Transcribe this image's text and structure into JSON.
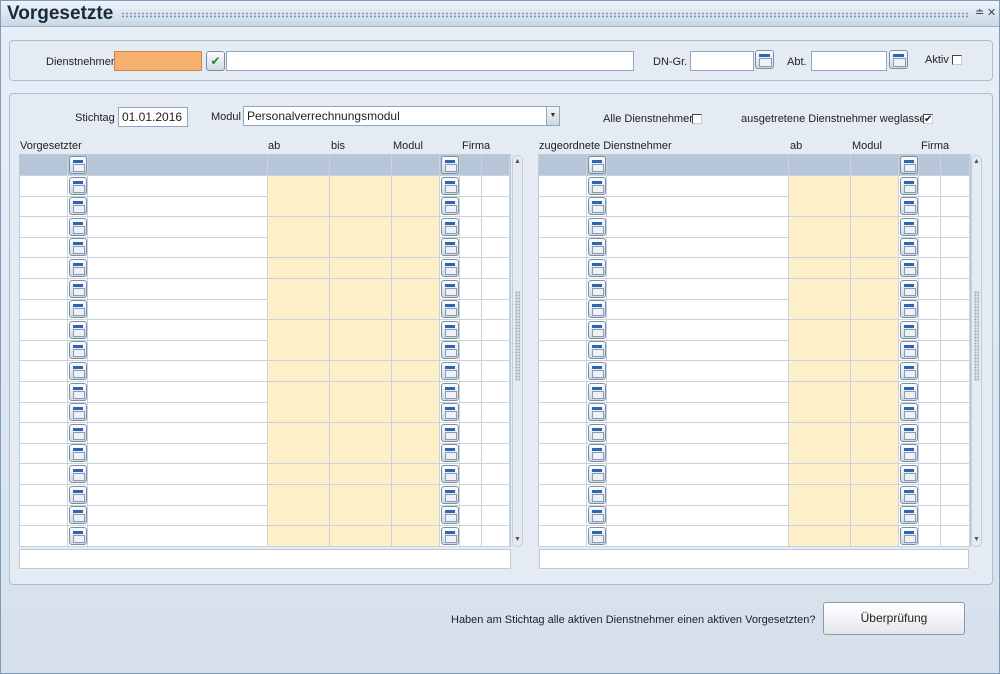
{
  "window": {
    "title": "Vorgesetzte",
    "min_glyph": "≐",
    "close_glyph": "✕"
  },
  "employee_panel": {
    "dienstnehmer_label": "Dienstnehmer",
    "dienstnehmer_value": "",
    "name_value": "",
    "dngr_label": "DN-Gr.",
    "dngr_value": "",
    "abt_label": "Abt.",
    "abt_value": "",
    "aktiv_label": "Aktiv",
    "aktiv_checked": false,
    "accent_color": "#f8b070"
  },
  "filter": {
    "stichtag_label": "Stichtag",
    "stichtag_value": "01.01.2016",
    "modul_label": "Modul",
    "modul_value": "Personalverrechnungsmodul",
    "alle_label": "Alle Dienstnehmer",
    "alle_checked": false,
    "ausgetretene_label": "ausgetretene Dienstnehmer weglassen",
    "ausgetretene_checked": true,
    "check_glyph": "✔"
  },
  "left_table": {
    "columns": [
      "Vorgesetzter",
      "ab",
      "bis",
      "Modul",
      "Firma"
    ],
    "row_count": 19,
    "selected_row": 0,
    "footer_value": ""
  },
  "right_table": {
    "columns": [
      "zugeordnete Dienstnehmer",
      "ab",
      "Modul",
      "Firma"
    ],
    "row_count": 19,
    "selected_row": 0,
    "footer_value": ""
  },
  "bottom": {
    "question": "Haben am Stichtag alle aktiven Dienstnehmer einen aktiven Vorgesetzten?",
    "check_button": "Überprüfung"
  },
  "icons": {
    "picker": "calendar-picker-icon",
    "confirm": "checkmark-icon",
    "scroll_up": "▲",
    "scroll_down": "▼"
  }
}
